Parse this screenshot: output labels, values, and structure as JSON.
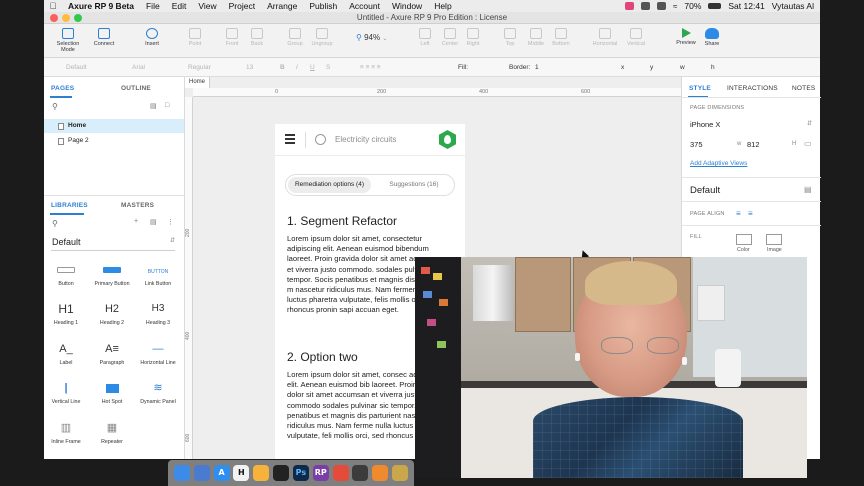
{
  "menubar": {
    "app_name": "Axure RP 9 Beta",
    "items": [
      "File",
      "Edit",
      "View",
      "Project",
      "Arrange",
      "Publish",
      "Account",
      "Window",
      "Help"
    ],
    "battery": "70%",
    "clock": "Sat 12:41",
    "user": "Vytautas Al"
  },
  "window": {
    "title": "Untitled - Axure RP 9 Pro Edition : License"
  },
  "toolbar": {
    "selection_mode": "Selection Mode",
    "connect": "Connect",
    "insert": "Insert",
    "point": "Point",
    "front": "Front",
    "back": "Back",
    "group": "Group",
    "ungroup": "Ungroup",
    "zoom": "94%",
    "left": "Left",
    "center": "Center",
    "right": "Right",
    "top": "Top",
    "middle": "Middle",
    "bottom": "Bottom",
    "horizontal": "Horizontal",
    "vertical": "Vertical",
    "preview": "Preview",
    "share": "Share"
  },
  "formatbar": {
    "style": "Default",
    "font": "Arial",
    "weight": "Regular",
    "size": "13",
    "fill": "Fill:",
    "border": "Border:",
    "border_width": "1",
    "x": "x",
    "y": "y",
    "w": "w",
    "h": "h"
  },
  "left_panel": {
    "tabs": {
      "pages": "PAGES",
      "outline": "OUTLINE"
    },
    "pages": [
      "Home",
      "Page 2"
    ],
    "lib_tabs": {
      "libraries": "LIBRARIES",
      "masters": "MASTERS"
    },
    "library_name": "Default",
    "widgets": [
      {
        "label": "Button",
        "glyph": ""
      },
      {
        "label": "Primary Button",
        "glyph": ""
      },
      {
        "label": "Link Button",
        "glyph": "BUTTON"
      },
      {
        "label": "Heading 1",
        "glyph": "H1"
      },
      {
        "label": "Heading 2",
        "glyph": "H2"
      },
      {
        "label": "Heading 3",
        "glyph": "H3"
      },
      {
        "label": "Label",
        "glyph": "A_"
      },
      {
        "label": "Paragraph",
        "glyph": "A≡"
      },
      {
        "label": "Horizontal Line",
        "glyph": "—"
      },
      {
        "label": "Vertical Line",
        "glyph": "|"
      },
      {
        "label": "Hot Spot",
        "glyph": ""
      },
      {
        "label": "Dynamic Panel",
        "glyph": "≋"
      },
      {
        "label": "Inline Frame",
        "glyph": "▥"
      },
      {
        "label": "Repeater",
        "glyph": "▦"
      }
    ]
  },
  "canvas": {
    "tab": "Home",
    "ruler_top": [
      "0",
      "200",
      "400",
      "600"
    ],
    "ruler_left": [
      "200",
      "400",
      "600"
    ]
  },
  "artboard": {
    "app_title": "Electricity circuits",
    "seg_active": "Remediation options (4)",
    "seg_inactive": "Suggestions (16)",
    "section1_title": "1. Segment Refactor",
    "section1_body": "Lorem ipsum dolor sit amet, consectetur adipiscing elit. Aenean euismod bibendum laoreet. Proin gravida dolor sit amet accumsan et viverra justo commodo. sodales pulvinar sic tempor. Socis penatibus et magnis dis parturient m nascetur ridiculus mus. Nam fermen nulla luctus pharetra vulputate, felis mollis orci, sed rhoncus pronin sapi accuan eget.",
    "section2_title": "2. Option two",
    "section2_body": "Lorem ipsum dolor sit amet, consec adipiscing elit. Aenean euismod bib laoreet. Proin gravida dolor sit amet accumsan et viverra justo commodo sodales pulvinar sic tempor. Socis penatibus et magnis dis parturient nascetur ridiculus mus. Nam ferme nulla luctus pharetra vulputate, feli mollis orci, sed rhoncus pronin sap"
  },
  "right_panel": {
    "tabs": {
      "style": "STYLE",
      "interactions": "INTERACTIONS",
      "notes": "NOTES"
    },
    "page_dimensions_label": "PAGE DIMENSIONS",
    "device": "iPhone X",
    "width": "375",
    "w_label": "w",
    "height": "812",
    "h_label": "H",
    "adaptive_link": "Add Adaptive Views",
    "style_name": "Default",
    "page_align_label": "PAGE ALIGN",
    "fill_label": "FILL",
    "fill_color": "Color",
    "fill_image": "Image"
  },
  "dock": {
    "apps": [
      "finder",
      "xcode",
      "app-store",
      "hypothesis",
      "sketch",
      "terminal",
      "photoshop",
      "axure",
      "chrome",
      "finalcut",
      "misc",
      "misc2"
    ]
  },
  "colors": {
    "accent": "#2d7fd3",
    "artboard_icon": "#2ca84e"
  }
}
